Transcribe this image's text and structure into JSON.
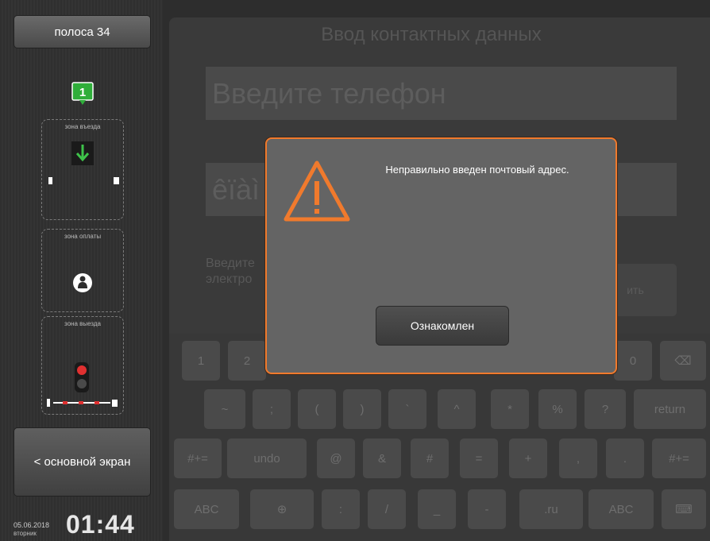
{
  "sidebar": {
    "lane_label": "полоса 34",
    "marker_number": "1",
    "zones": [
      {
        "label": "зона въезда"
      },
      {
        "label": "зона оплаты"
      },
      {
        "label": "зона выезда"
      }
    ],
    "home_label": "< основной экран",
    "date": "05.06.2018",
    "weekday": "вторник",
    "time": "01:44"
  },
  "form": {
    "title": "Ввод контактных данных",
    "phone_placeholder": "Введите телефон",
    "email_value": "êïàì",
    "hint_line1": "Введите",
    "hint_line2": "электро",
    "skip_label": "ить"
  },
  "keyboard": {
    "row1": [
      "1",
      "2",
      "0",
      "⌫"
    ],
    "row2": [
      "~",
      ";",
      "(",
      ")",
      "`",
      "^",
      "*",
      "%",
      "?",
      "return"
    ],
    "row3": [
      "#+=",
      "undo",
      "@",
      "&",
      "#",
      "=",
      "+",
      ",",
      ".",
      "#+="
    ],
    "row4": [
      "ABC",
      "⊕",
      ":",
      "/",
      "_",
      "-",
      ".ru",
      "ABC",
      "⌨"
    ]
  },
  "modal": {
    "message": "Неправильно введен почтовый адрес.",
    "button_label": "Ознакомлен"
  },
  "colors": {
    "accent_orange": "#f07a2d",
    "marker_green": "#2fae3a",
    "signal_red": "#e03030"
  }
}
